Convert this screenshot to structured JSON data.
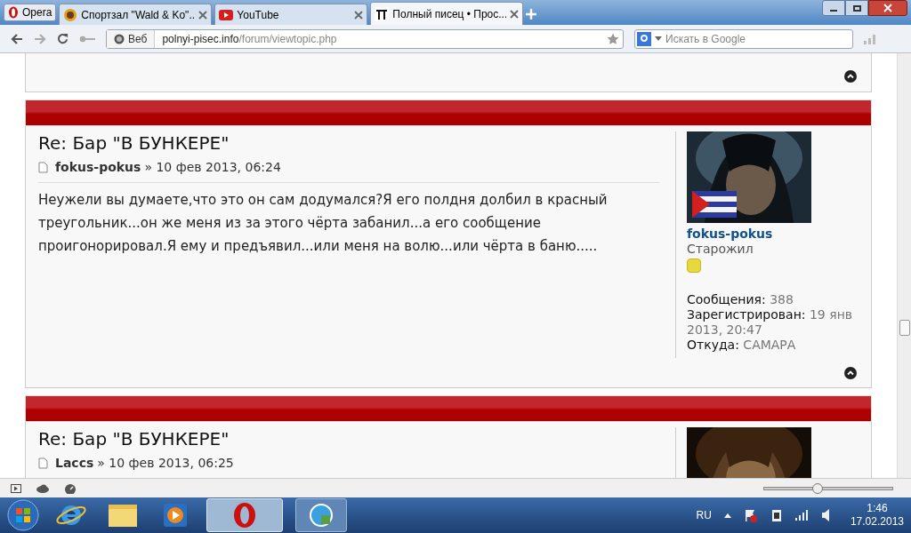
{
  "browser": {
    "menu_label": "Opera",
    "tabs": [
      {
        "title": "Спортзал \"Wald & Ko\"...",
        "kind": "sport",
        "selected": false
      },
      {
        "title": "YouTube",
        "kind": "youtube",
        "selected": false
      },
      {
        "title": "Полный писец • Прос...",
        "kind": "forum",
        "selected": true
      }
    ],
    "address": {
      "badge": "Веб",
      "domain": "polnyi-pisec.info",
      "path": "/forum/viewtopic.php"
    },
    "search": {
      "placeholder": "Искать в Google"
    }
  },
  "posts": [
    {
      "title": "Re: Бар \"В БУНКЕРЕ\"",
      "author": "fokus-pokus",
      "date": "» 10 фев 2013, 06:24",
      "body": "Неужели вы думаете,что это он сам додумался?Я его полдня долбил в красный треугольник...он же меня из за этого чёрта забанил...а его сообщение проигонорировал.Я ему и предъявил...или меня на волю...или чёрта в баню.....",
      "profile": {
        "name": "fokus-pokus",
        "rank": "Старожил",
        "fields": [
          {
            "label": "Сообщения:",
            "value": "388"
          },
          {
            "label": "Зарегистрирован:",
            "value": "19 янв 2013, 20:47"
          },
          {
            "label": "Откуда:",
            "value": "САМАРА"
          }
        ]
      }
    },
    {
      "title": "Re: Бар \"В БУНКЕРЕ\"",
      "author": "Laccs",
      "date": "» 10 фев 2013, 06:25"
    }
  ],
  "zoom": {
    "level": 0.42
  },
  "taskbar": {
    "language": "RU",
    "time": "1:46",
    "date": "17.02.2013"
  }
}
